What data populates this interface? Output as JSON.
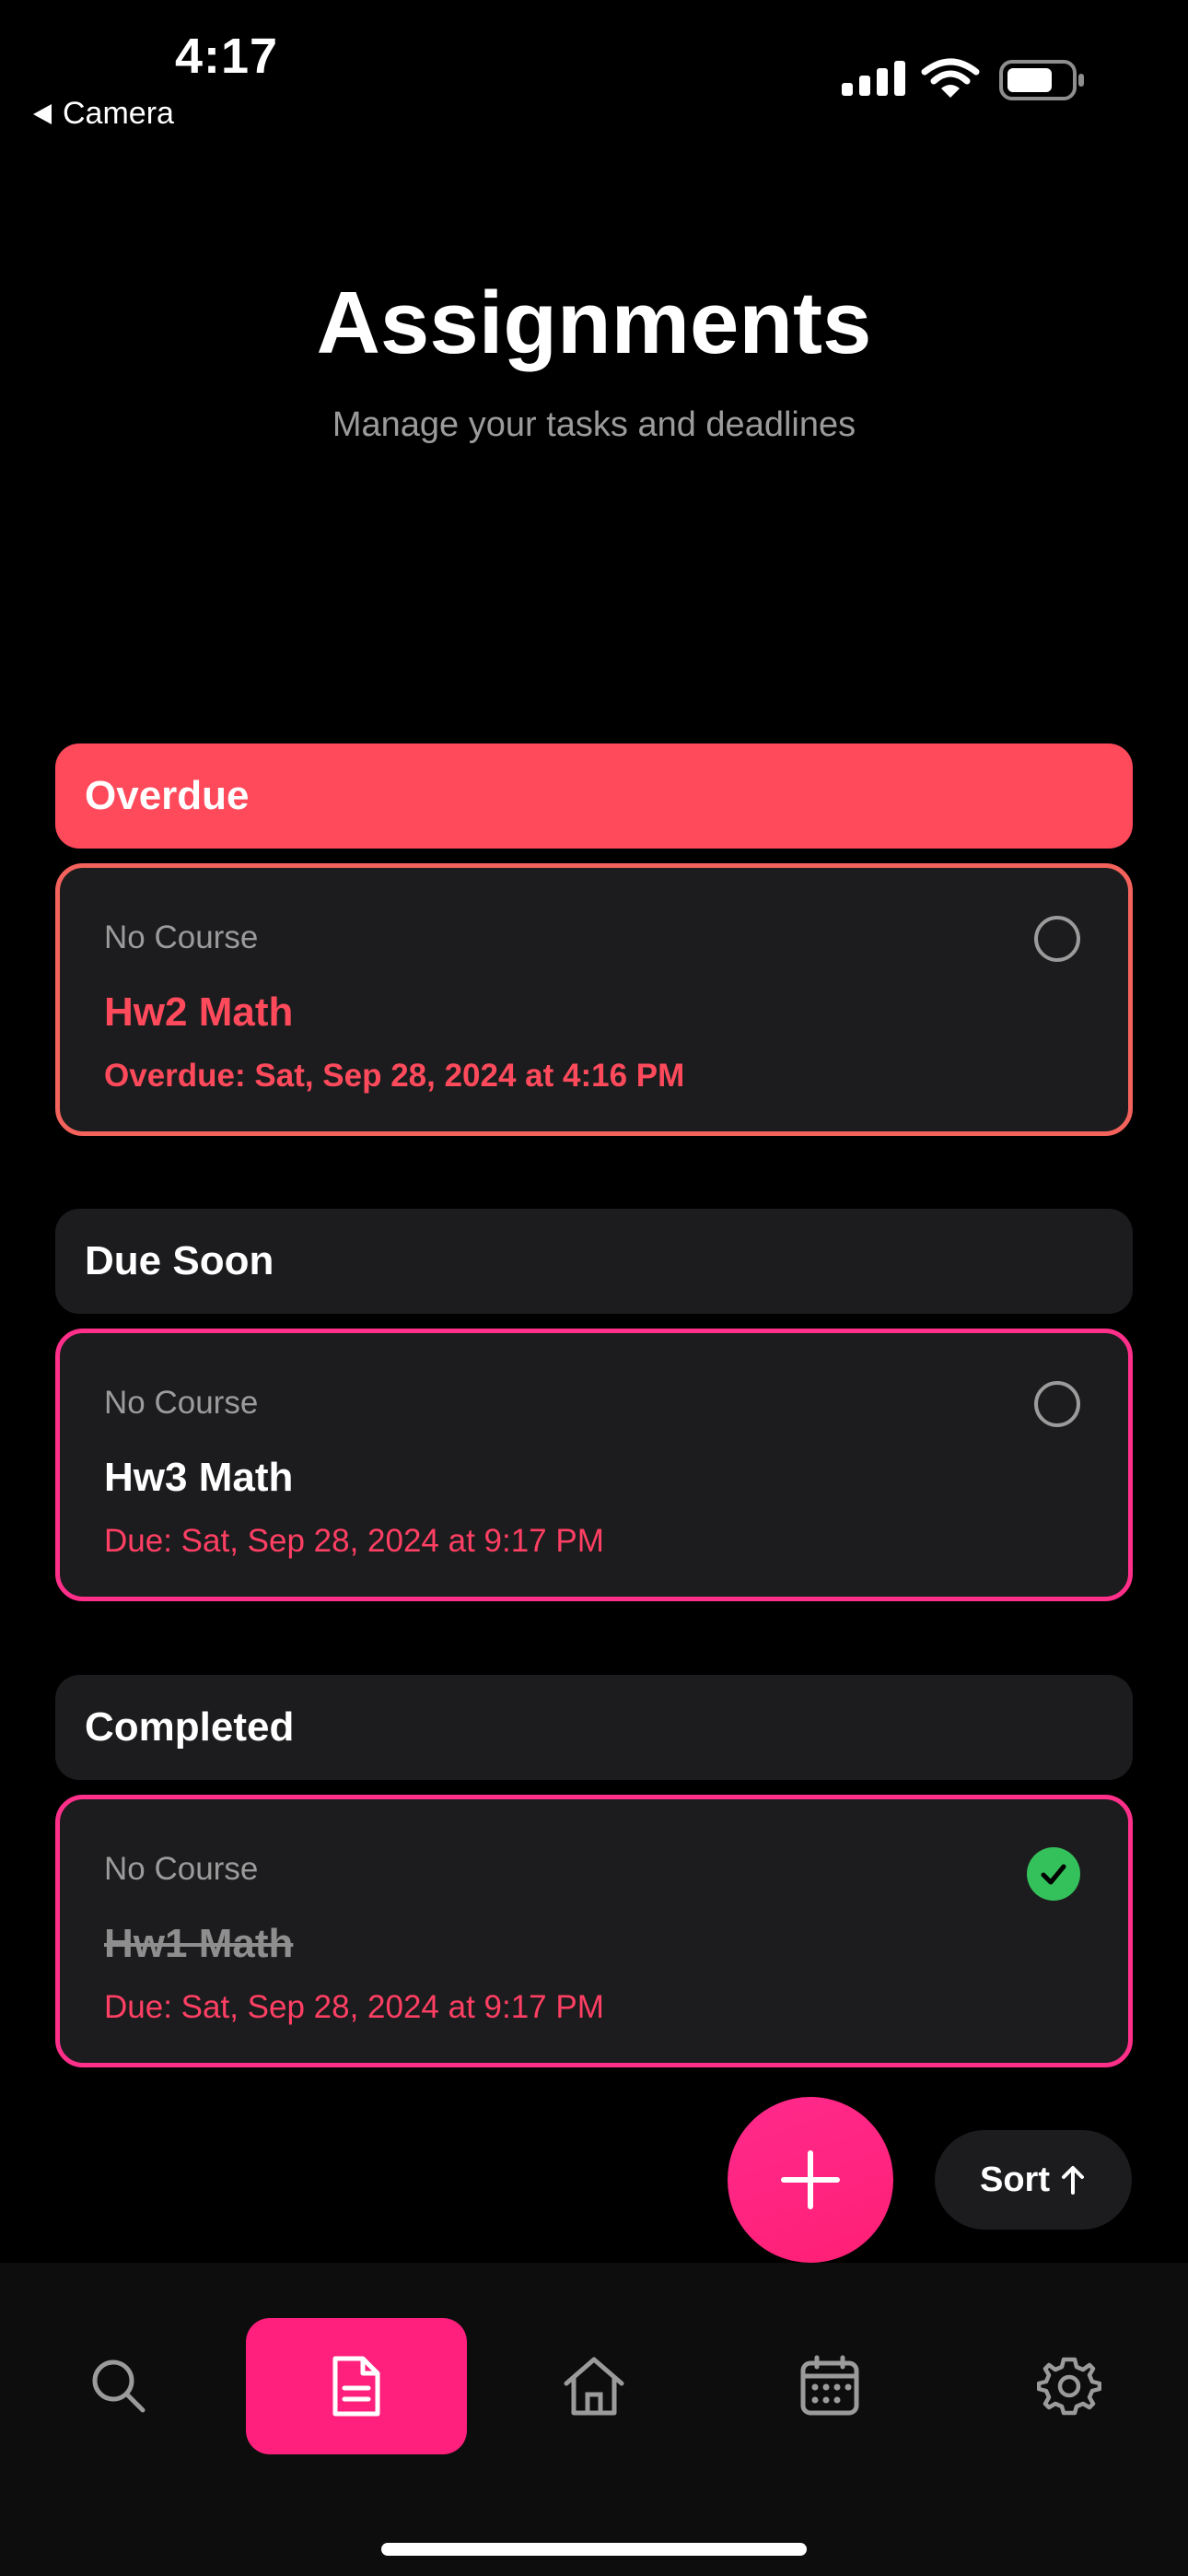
{
  "status_bar": {
    "time": "4:17",
    "back_label": "Camera"
  },
  "header": {
    "title": "Assignments",
    "subtitle": "Manage your tasks and deadlines"
  },
  "sections": [
    {
      "title": "Overdue",
      "cards": [
        {
          "course": "No Course",
          "name": "Hw2 Math",
          "due": "Overdue: Sat, Sep 28, 2024 at 4:16 PM",
          "completed": false
        }
      ]
    },
    {
      "title": "Due Soon",
      "cards": [
        {
          "course": "No Course",
          "name": "Hw3 Math",
          "due": "Due: Sat, Sep 28, 2024 at 9:17 PM",
          "completed": false
        }
      ]
    },
    {
      "title": "Completed",
      "cards": [
        {
          "course": "No Course",
          "name": "Hw1 Math",
          "due": "Due: Sat, Sep 28, 2024 at 9:17 PM",
          "completed": true
        }
      ]
    }
  ],
  "actions": {
    "sort_label": "Sort"
  },
  "tabs": [
    {
      "icon": "search-icon",
      "active": false
    },
    {
      "icon": "document-icon",
      "active": true
    },
    {
      "icon": "home-icon",
      "active": false
    },
    {
      "icon": "calendar-icon",
      "active": false
    },
    {
      "icon": "gear-icon",
      "active": false
    }
  ],
  "colors": {
    "accent": "#ff1f7d",
    "overdue": "#ff4a5c",
    "complete": "#34c05a",
    "card_bg": "#1c1c1e"
  }
}
